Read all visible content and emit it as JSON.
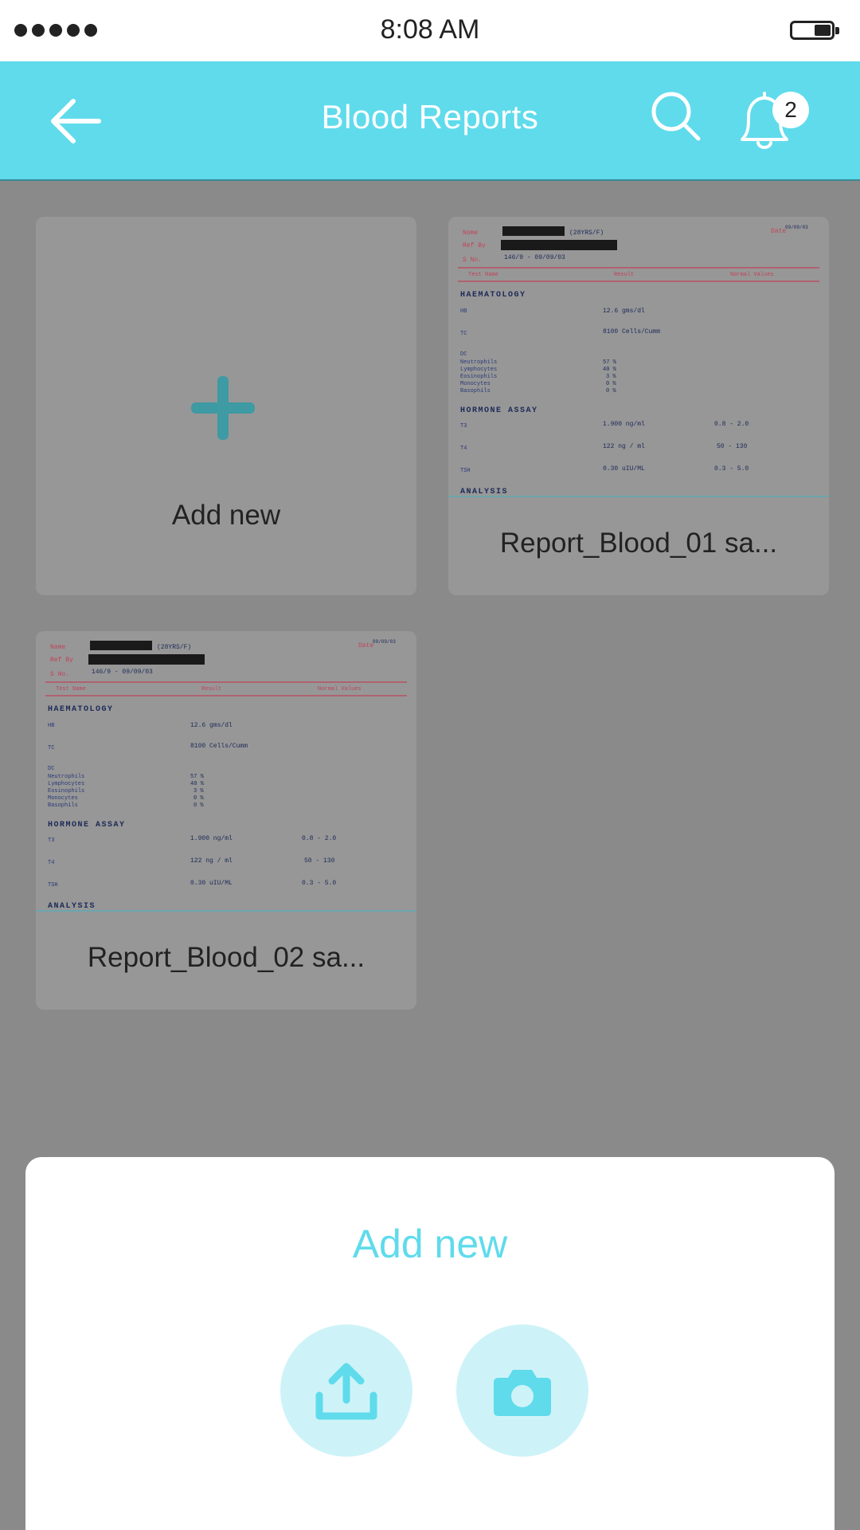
{
  "status_bar": {
    "time": "8:08 AM"
  },
  "header": {
    "title": "Blood Reports",
    "notification_count": "2"
  },
  "grid": {
    "add_card_label": "Add new",
    "reports": [
      {
        "name": "Report_Blood_01 sa..."
      },
      {
        "name": "Report_Blood_02 sa..."
      }
    ]
  },
  "report_preview": {
    "name_label": "Name",
    "patient": "(28YRS/F)",
    "date_label": "Date",
    "date_value": "09/09/03",
    "ref_label": "Ref By",
    "sno_label": "S No.",
    "sno_value": "146/9 - 09/09/03",
    "col_test": "Test Name",
    "col_result": "Result",
    "col_normal": "Normal Values",
    "section_haem": "HAEMATOLOGY",
    "hb": "HB",
    "hb_val": "12.6 gms/dl",
    "tc": "TC",
    "tc_val": "8100 Cells/Cumm",
    "dc": "DC",
    "neut": "Neutrophils",
    "neut_val": "57 %",
    "lymph": "Lymphocytes",
    "lymph_val": "40 %",
    "eos": "Eosinophils",
    "eos_val": "3 %",
    "mono": "Monocytes",
    "mono_val": "0 %",
    "baso": "Basophils",
    "baso_val": "0 %",
    "section_hormone": "HORMONE ASSAY",
    "t3": "T3",
    "t3_val": "1.900 ng/ml",
    "t3_norm": "0.8 - 2.0",
    "t4": "T4",
    "t4_val": "122 ng / ml",
    "t4_norm": "50 - 130",
    "tsh": "TSH",
    "tsh_val": "0.30 uIU/ML",
    "tsh_norm": "0.3 - 5.0",
    "section_analysis": "ANALYSIS"
  },
  "sheet": {
    "title": "Add new"
  },
  "icons": {
    "back": "back-arrow-icon",
    "search": "search-icon",
    "bell": "bell-icon",
    "plus": "plus-icon",
    "upload": "upload-icon",
    "camera": "camera-icon"
  },
  "colors": {
    "accent": "#5fdbec",
    "overlay": "#8a8a8a",
    "card": "#979797",
    "plus": "#3e9aa3"
  }
}
